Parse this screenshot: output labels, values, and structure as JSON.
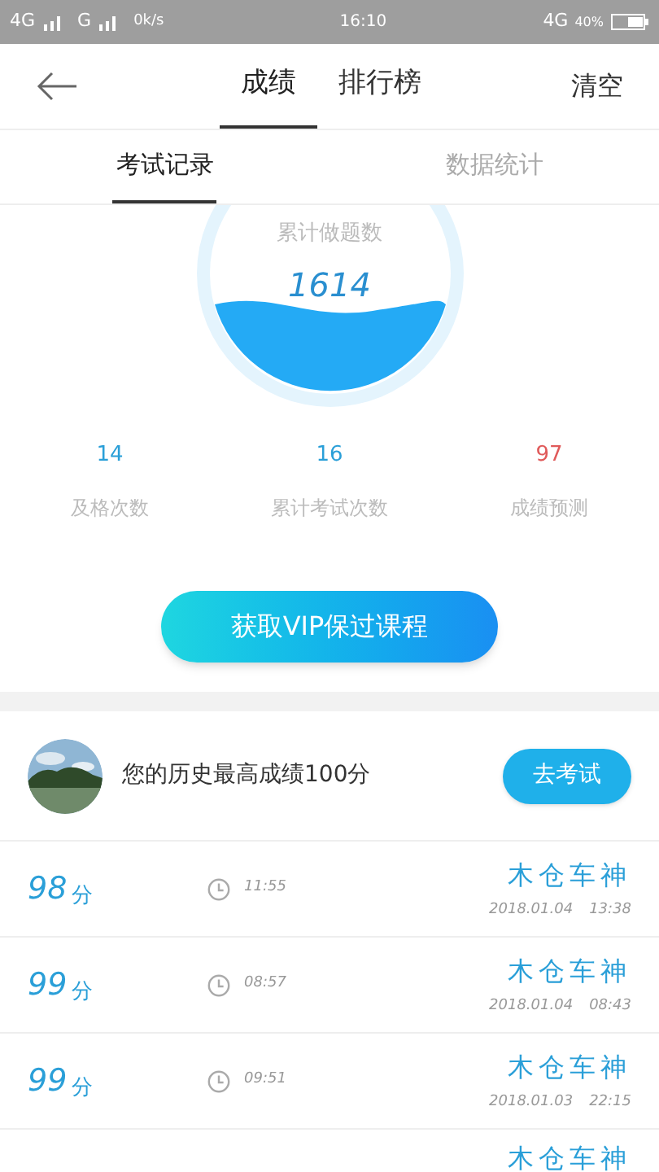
{
  "status_bar": {
    "network_1": "4G",
    "network_2": "G",
    "speed": "0k/s",
    "time": "16:10",
    "network_3": "4G",
    "battery": "40%"
  },
  "header": {
    "tabs": [
      {
        "label": "成绩",
        "selected": true
      },
      {
        "label": "排行榜",
        "selected": false
      }
    ],
    "action": "清空"
  },
  "sub_tabs": [
    {
      "label": "考试记录",
      "selected": true
    },
    {
      "label": "数据统计",
      "selected": false
    }
  ],
  "summary": {
    "label": "累计做题数",
    "value": "1614"
  },
  "stats": [
    {
      "value": "14",
      "label": "及格次数",
      "color": "#2a9fd8"
    },
    {
      "value": "16",
      "label": "累计考试次数",
      "color": "#2a9fd8"
    },
    {
      "value": "97",
      "label": "成绩预测",
      "color": "#e05a5a"
    }
  ],
  "vip_button": "获取VIP保过课程",
  "profile": {
    "text": "您的历史最高成绩100分",
    "button": "去考试"
  },
  "records": [
    {
      "score": "98",
      "unit": "分",
      "duration": "11:55",
      "name": "木仓车神",
      "date": "2018.01.04",
      "time": "13:38"
    },
    {
      "score": "99",
      "unit": "分",
      "duration": "08:57",
      "name": "木仓车神",
      "date": "2018.01.04",
      "time": "08:43"
    },
    {
      "score": "99",
      "unit": "分",
      "duration": "09:51",
      "name": "木仓车神",
      "date": "2018.01.03",
      "time": "22:15"
    },
    {
      "name": "木仓车神"
    }
  ]
}
